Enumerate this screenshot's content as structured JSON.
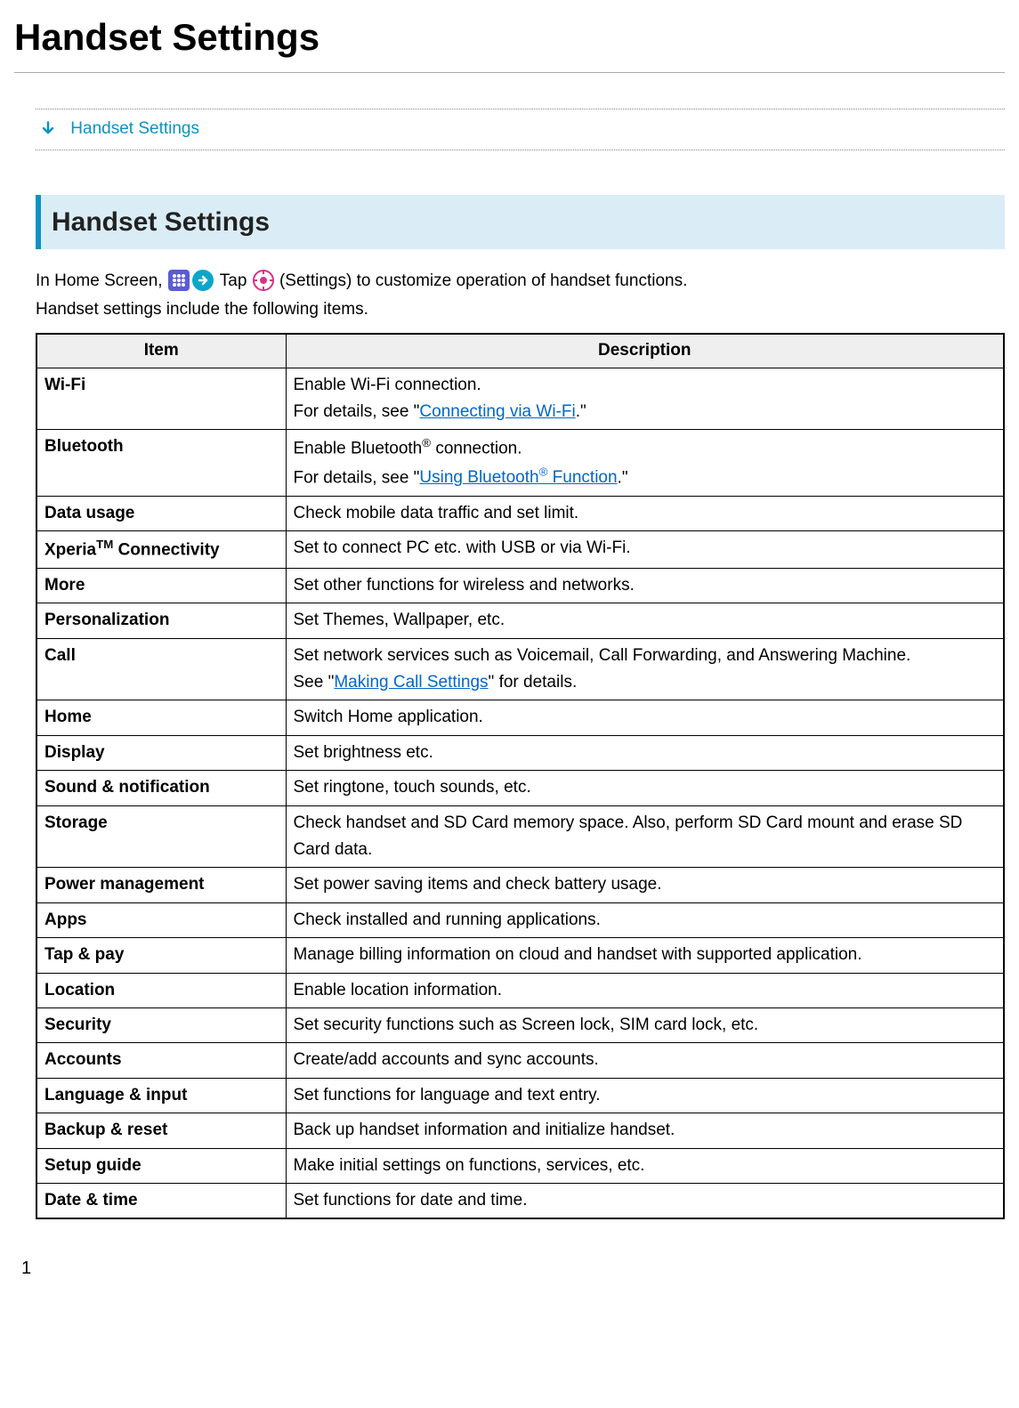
{
  "page_title": "Handset Settings",
  "toc_link": "Handset Settings",
  "section_heading": "Handset Settings",
  "intro": {
    "part1": "In Home Screen, ",
    "tap": " Tap ",
    "part2": " (Settings) to customize operation of handset functions.",
    "line2": "Handset settings include the following items."
  },
  "table_headers": {
    "item": "Item",
    "description": "Description"
  },
  "rows": {
    "wifi": {
      "item": "Wi-Fi",
      "desc1": "Enable Wi-Fi connection.",
      "desc2a": "For details, see \"",
      "link": "Connecting via Wi-Fi",
      "desc2b": ".\""
    },
    "bluetooth": {
      "item": "Bluetooth",
      "desc1a": "Enable Bluetooth",
      "desc1b": " connection.",
      "desc2a": "For details, see \"",
      "link_a": "Using Bluetooth",
      "link_b": " Function",
      "desc2b": ".\""
    },
    "data_usage": {
      "item": "Data usage",
      "desc": "Check mobile data traffic and set limit."
    },
    "xperia": {
      "item_a": "Xperia",
      "item_b": " Connectivity",
      "desc": "Set to connect PC etc. with USB or via Wi-Fi."
    },
    "more": {
      "item": "More",
      "desc": "Set other functions for wireless and networks."
    },
    "personalization": {
      "item": "Personalization",
      "desc": "Set Themes, Wallpaper, etc."
    },
    "call": {
      "item": "Call",
      "desc1": "Set network services such as Voicemail, Call Forwarding, and Answering Machine.",
      "desc2a": "See \"",
      "link": "Making Call Settings",
      "desc2b": "\" for details."
    },
    "home": {
      "item": "Home",
      "desc": "Switch Home application."
    },
    "display": {
      "item": "Display",
      "desc": "Set brightness etc."
    },
    "sound": {
      "item": "Sound & notification",
      "desc": "Set ringtone, touch sounds, etc."
    },
    "storage": {
      "item": "Storage",
      "desc": "Check handset and SD Card memory space. Also, perform SD Card mount and erase SD Card data."
    },
    "power": {
      "item": "Power management",
      "desc": "Set power saving items and check battery usage."
    },
    "apps": {
      "item": "Apps",
      "desc": "Check installed and running applications."
    },
    "tap_pay": {
      "item": "Tap & pay",
      "desc": "Manage billing information on cloud and handset with supported application."
    },
    "location": {
      "item": "Location",
      "desc": "Enable location information."
    },
    "security": {
      "item": "Security",
      "desc": "Set security functions such as Screen lock, SIM card lock, etc."
    },
    "accounts": {
      "item": "Accounts",
      "desc": "Create/add accounts and sync accounts."
    },
    "language": {
      "item": "Language & input",
      "desc": "Set functions for language and text entry."
    },
    "backup": {
      "item": "Backup & reset",
      "desc": "Back up handset information and initialize handset."
    },
    "setup": {
      "item": "Setup guide",
      "desc": "Make initial settings on functions, services, etc."
    },
    "date_time": {
      "item": "Date & time",
      "desc": "Set functions for date and time."
    }
  },
  "page_number": "1"
}
